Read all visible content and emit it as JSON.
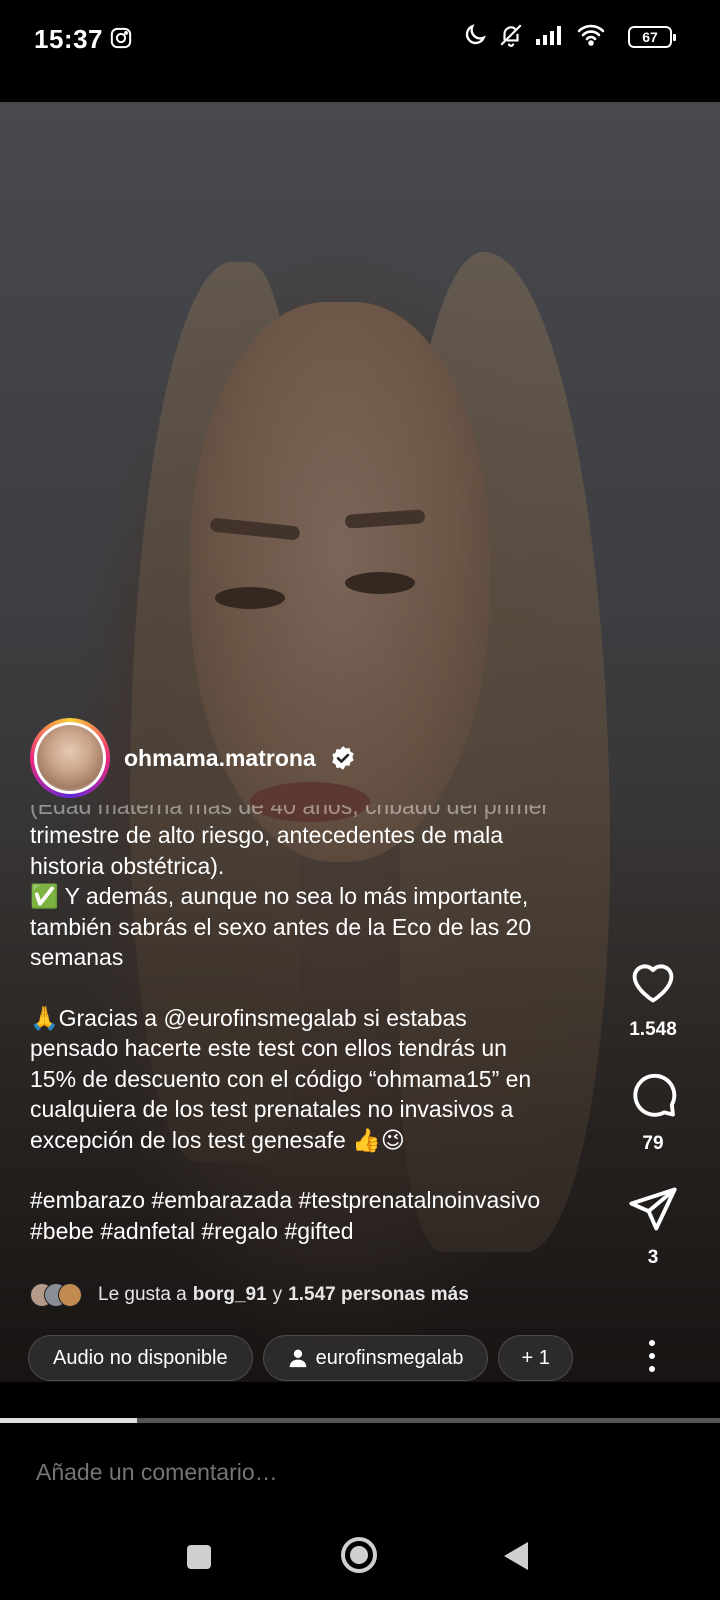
{
  "status_bar": {
    "time": "15:37",
    "battery": "67",
    "icons": [
      "instagram-icon",
      "moon-icon",
      "bell-off-icon",
      "signal-icon",
      "wifi-icon",
      "battery-icon"
    ]
  },
  "post": {
    "username": "ohmama.matrona",
    "verified": true,
    "caption_cut_line": "(Edad materna más de 40 años, cribado del primer",
    "caption_lines": [
      "trimestre de alto riesgo, antecedentes de mala",
      "historia obstétrica).",
      "✅ Y además, aunque no sea lo más importante,",
      "también sabrás el sexo antes de la Eco de las 20",
      "semanas",
      "",
      "🙏Gracias a @eurofinsmegalab si estabas",
      "pensado hacerte este test con ellos tendrás un",
      "15% de descuento con el código “ohmama15” en",
      "cualquiera de los test prenatales no invasivos a",
      "excepción de los test genesafe 👍😉",
      "",
      "#embarazo #embarazada #testprenatalnoinvasivo",
      "#bebe #adnfetal #regalo #gifted"
    ],
    "likes": {
      "prefix": "Le gusta a",
      "user": "borg_91",
      "middle": "y",
      "others": "1.547 personas más"
    },
    "chips": {
      "audio": "Audio no disponible",
      "tagged": "eurofinsmegalab",
      "more": "+ 1"
    }
  },
  "actions": {
    "like_count": "1.548",
    "comment_count": "79",
    "share_count": "3"
  },
  "progress": 0.19,
  "comment": {
    "placeholder": "Añade un comentario…"
  },
  "colors": {
    "background": "#000000",
    "caption_text": "#ffffff",
    "placeholder": "#8e8e8e"
  }
}
